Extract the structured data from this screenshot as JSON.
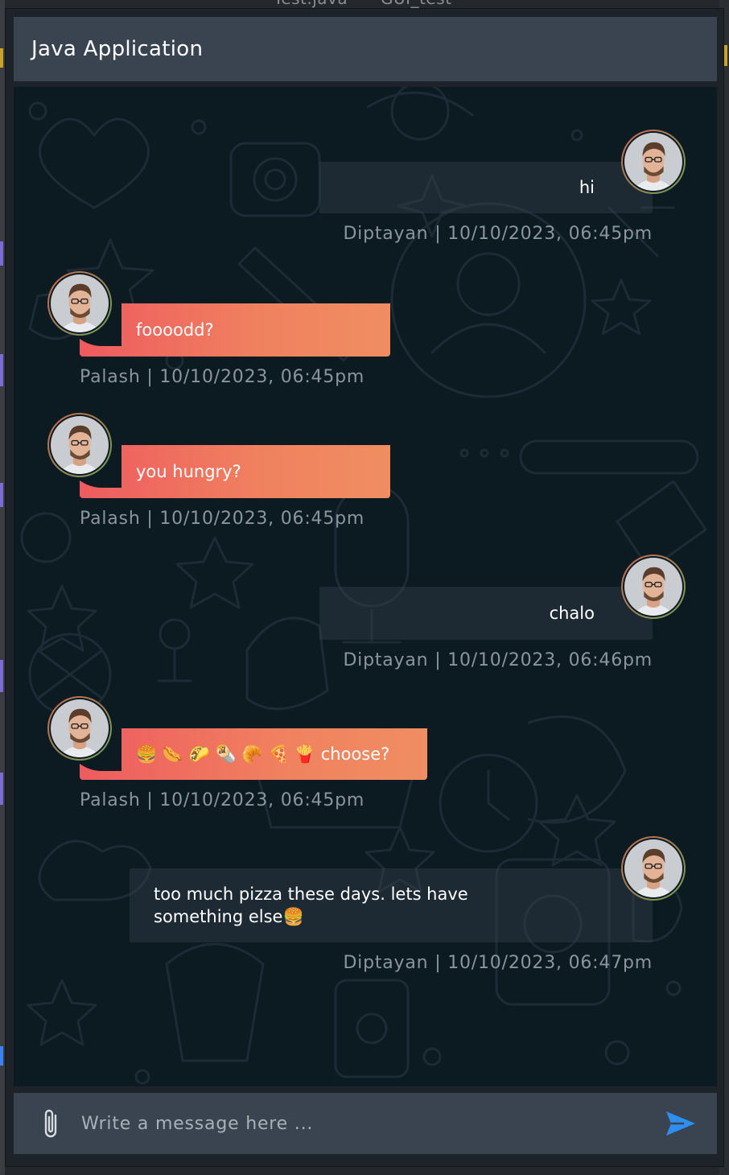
{
  "background_window": {
    "tabs": [
      "Test.java",
      "GUI_test"
    ]
  },
  "window": {
    "title": "Java Application"
  },
  "colors": {
    "incoming_gradient_start": "#ee5b5f",
    "incoming_gradient_end": "#f08d62",
    "chat_background": "#0c1a22",
    "header_background": "#394450",
    "send_icon": "#2e8ff0"
  },
  "messages": [
    {
      "direction": "outgoing",
      "text": "hi",
      "meta": "Diptayan | 10/10/2023, 06:45pm"
    },
    {
      "direction": "incoming",
      "text": "foooodd?",
      "meta": "Palash | 10/10/2023, 06:45pm"
    },
    {
      "direction": "incoming",
      "text": "you hungry?",
      "meta": "Palash | 10/10/2023, 06:45pm"
    },
    {
      "direction": "outgoing",
      "text": "chalo",
      "meta": "Diptayan | 10/10/2023, 06:46pm"
    },
    {
      "direction": "incoming",
      "text": "🍔 🌭 🌮 🌯 🥐 🍕 🍟  choose?",
      "meta": "Palash | 10/10/2023, 06:45pm"
    },
    {
      "direction": "outgoing",
      "text": "too much pizza these days. lets have something else🍔",
      "meta": "Diptayan | 10/10/2023, 06:47pm"
    }
  ],
  "composer": {
    "placeholder": "Write a message here ...",
    "attach_icon": "paperclip-icon",
    "send_icon": "send-icon"
  }
}
